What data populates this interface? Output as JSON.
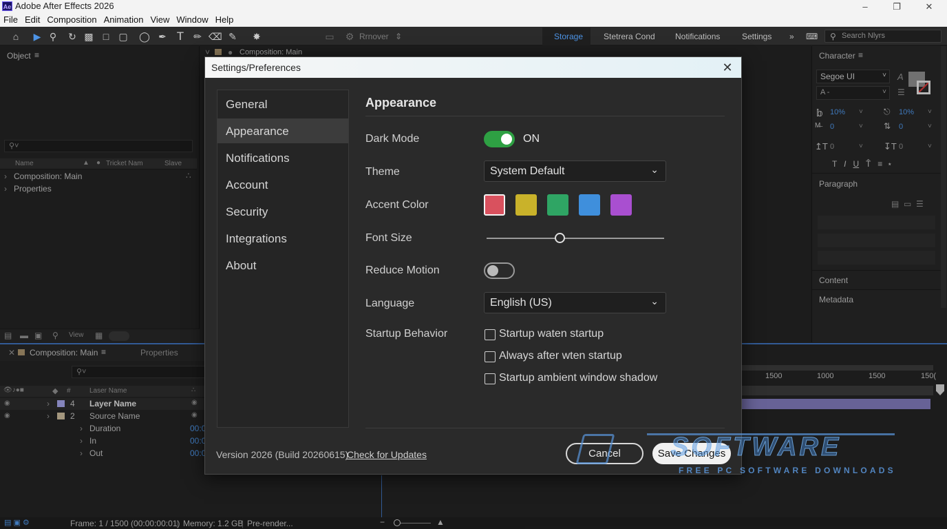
{
  "app": {
    "title": "Adobe After Effects 2026",
    "logo": "Ae"
  },
  "menu": [
    "File",
    "Edit",
    "Composition",
    "Animation",
    "View",
    "Window",
    "Help"
  ],
  "toolbar": {
    "rmover": "Rrnover",
    "workspaces": [
      "Storage",
      "Stetrera Cond",
      "Notifications",
      "Settings"
    ],
    "active_workspace": "Storage",
    "search_placeholder": "Search Nlyrs"
  },
  "project_panel": {
    "title": "Object",
    "columns": [
      "Name",
      "Tricket Nam",
      "Slave"
    ],
    "items": [
      "Composition: Main",
      "Properties"
    ],
    "bottom_label": "View"
  },
  "comp_header": {
    "title": "Composition: Main"
  },
  "timeline": {
    "tab_active": "Composition: Main",
    "tab_other": "Properties",
    "column_layer": "Laser Name",
    "rows": [
      {
        "num": "4",
        "name": "Layer Name",
        "bold": true
      },
      {
        "num": "2",
        "name": "Source Name",
        "bold": false
      }
    ],
    "props": [
      {
        "name": "Duration",
        "val": "00:0"
      },
      {
        "name": "In",
        "val": "00:0"
      },
      {
        "name": "Out",
        "val": "00:0"
      }
    ],
    "ruler": [
      "1500",
      "1000",
      "1500",
      "150("
    ]
  },
  "character_panel": {
    "title": "Character",
    "font": "Segoe UI",
    "style": "A -",
    "vals": [
      "10%",
      "10%",
      "0",
      "0",
      "0",
      "0"
    ],
    "paragraph": "Paragraph",
    "content": "Content",
    "metadata": "Metadata"
  },
  "status": {
    "frame": "Frame: 1 / 1500 (00:00:00:01)",
    "memory": "Memory: 1.2 GB",
    "prerender": "Pre-render..."
  },
  "dialog": {
    "title": "Settings/Preferences",
    "nav": [
      "General",
      "Appearance",
      "Notifications",
      "Account",
      "Security",
      "Integrations",
      "About"
    ],
    "selected_nav": "Appearance",
    "section_title": "Appearance",
    "dark_mode": {
      "label": "Dark Mode",
      "state": "ON"
    },
    "theme": {
      "label": "Theme",
      "value": "System Default"
    },
    "accent": {
      "label": "Accent Color",
      "colors": [
        "#d9515e",
        "#c9b22a",
        "#2fa564",
        "#3f8fdc",
        "#a94fd0"
      ],
      "selected": 0
    },
    "font_size": {
      "label": "Font Size",
      "value": 0.41
    },
    "reduce_motion": {
      "label": "Reduce Motion"
    },
    "language": {
      "label": "Language",
      "value": "English (US)"
    },
    "startup": {
      "label": "Startup Behavior",
      "options": [
        "Startup waten startup",
        "Always after wten startup",
        "Startup ambient window shadow"
      ]
    },
    "version": "Version 2026 (Build 20260615)",
    "check_updates": "Check for Updates",
    "cancel": "Cancel",
    "save": "Save Changes"
  },
  "watermark": {
    "big": "SOFTWARE",
    "small": "FREE PC SOFTWARE DOWNLOADS"
  }
}
